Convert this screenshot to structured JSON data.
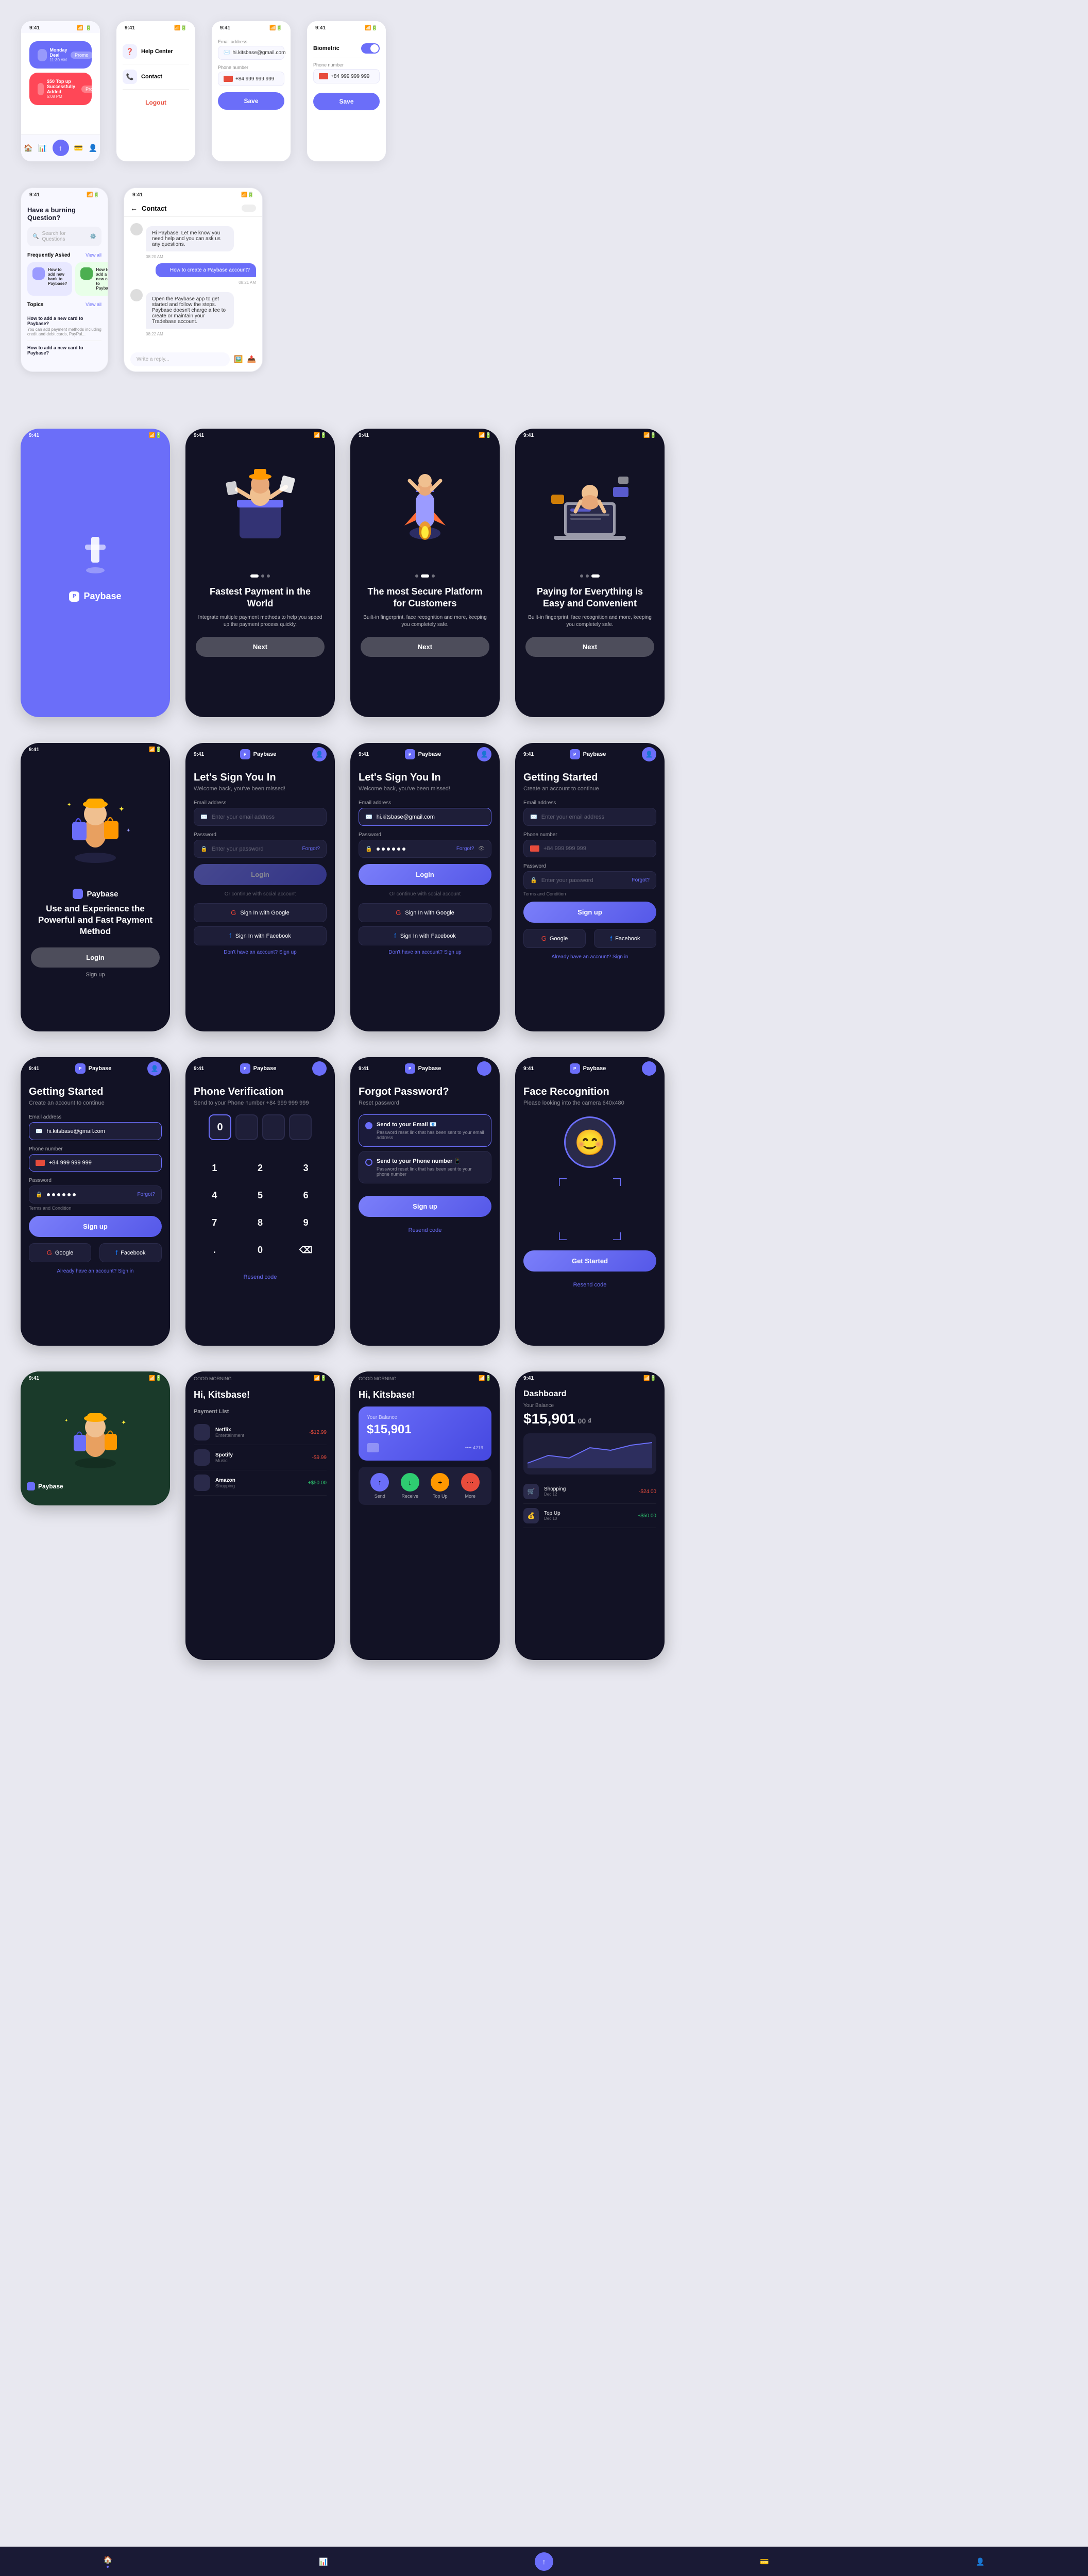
{
  "app": {
    "name": "Paybase",
    "logo_text": "Paybase",
    "tagline": "Use and Experience the Powerful and Fast Payment Method"
  },
  "status_bar": {
    "time": "9:41",
    "time_good_morning": "GOOD MORNING"
  },
  "row1": {
    "screens": [
      {
        "id": "notifications",
        "items": [
          {
            "title": "Monday Deal",
            "amount": "11:30 AM",
            "badge": "Promo",
            "color": "blue"
          },
          {
            "title": "$50 Top up Successfully Added",
            "amount": "5:08 PM",
            "badge": "Promo",
            "color": "red"
          }
        ],
        "nav": [
          "home",
          "activity",
          "send",
          "card",
          "profile"
        ]
      },
      {
        "id": "help-center",
        "title": "Help Center",
        "contact": "Contact",
        "logout": "Logout"
      },
      {
        "id": "profile-settings",
        "email_label": "Email address",
        "email_value": "hi.kitsbase@gmail.com",
        "phone_label": "Phone number",
        "phone_value": "+84 999 999 999",
        "save_btn": "Save"
      },
      {
        "id": "biometric",
        "title": "Biometric",
        "phone_label": "Phone number",
        "phone_value": "+84 999 999 999",
        "save_btn": "Save"
      }
    ]
  },
  "row2": {
    "faq": {
      "title": "Have a burning Question?",
      "search_placeholder": "Search for Questions",
      "frequently_asked": "Frequently Asked",
      "view_all": "View all",
      "topics": "Topics",
      "topics_view_all": "View all",
      "cards": [
        {
          "title": "How to add new bank to Paybase?"
        },
        {
          "title": "How to add a new card to Paybase?"
        }
      ],
      "topic_items": [
        {
          "title": "How to add a new card to Paybase?",
          "desc": "You can add payment methods including credit and debit cards, PayPal..."
        },
        {
          "title": "How to add a new card to Paybase?",
          "desc": ""
        }
      ]
    },
    "chat": {
      "title": "Contact",
      "messages": [
        {
          "side": "left",
          "text": "Hi Paybase, Let me know you need help and you can ask us any questions.",
          "time": "08:20 AM"
        },
        {
          "side": "right",
          "text": "How to create a Paybase account?",
          "time": "08:21 AM"
        },
        {
          "side": "left",
          "text": "Open the Paybase app to get started and follow the steps. Paybase doesn't charge a fee to create or maintain your Tradebase account.",
          "time": "08:22 AM"
        }
      ],
      "reply_placeholder": "Write a reply..."
    }
  },
  "onboarding": {
    "splash": {
      "logo": "Paybase"
    },
    "slides": [
      {
        "title": "Fastest Payment in the World",
        "desc": "Integrate multiple payment methods to help you speed up the payment process quickly.",
        "dot_active": 0
      },
      {
        "title": "The most Secure Platform for Customers",
        "desc": "Built-in fingerprint, face recognition and more, keeping you completely safe.",
        "dot_active": 1
      },
      {
        "title": "Paying for Everything is Easy and Convenient",
        "desc": "Built-in fingerprint, face recognition and more, keeping you completely safe.",
        "dot_active": 2
      }
    ],
    "next_btn": "Next"
  },
  "auth": {
    "welcome_back": "Welcome back, you've been missed!",
    "sign_in_title": "Let's Sign You In",
    "getting_started_title": "Getting Started",
    "getting_started_subtitle": "Create an account to continue",
    "email_label": "Email address",
    "email_placeholder": "Enter your email address",
    "email_value": "hi.kitsbase@gmail.com",
    "password_label": "Password",
    "password_placeholder": "Enter your password",
    "forgot_password": "Forgot?",
    "login_btn": "Login",
    "or_continue": "Or continue with social account",
    "google_btn": "Sign In with Google",
    "facebook_btn": "Sign In with Facebook",
    "no_account": "Don't have an account?",
    "signup_link": "Sign up",
    "phone_label": "Phone number",
    "phone_value": "+84 999 999 999",
    "phone_placeholder": "+84 999 999 999",
    "signup_btn": "Sign up",
    "already_have": "Already have an account?",
    "signin_link": "Sign in",
    "terms": "Terms and Condition",
    "google_label": "Google",
    "facebook_label": "Facebook"
  },
  "phone_verify": {
    "title": "Phone Verification",
    "subtitle": "Send to your Phone number +84 999 999 999",
    "code_digits": [
      "0",
      "",
      "",
      ""
    ],
    "numpad": [
      "1",
      "2",
      "3",
      "4",
      "5",
      "6",
      "7",
      "8",
      "9",
      ".",
      "0",
      "⌫"
    ],
    "resend": "Resend code",
    "send_to_phone": "Send to your Phone number"
  },
  "forgot_password": {
    "title": "Forgot Password?",
    "subtitle": "Reset password",
    "options": [
      {
        "id": "email",
        "label": "Send to your Email 📧",
        "desc": "Password reset link that has been sent to your email address",
        "selected": true
      },
      {
        "id": "phone",
        "label": "Send to your Phone number 📱",
        "desc": "Password reset link that has been sent to your phone number",
        "selected": false
      }
    ],
    "signup_btn": "Sign up",
    "resend": "Resend code"
  },
  "face_recognition": {
    "title": "Face Recognition",
    "subtitle": "Please looking into the camera 640x480",
    "get_started_btn": "Get Started",
    "resend": "Resend code"
  },
  "home": {
    "greeting_label": "GOOD MORNING",
    "greeting_name": "Hi, Kitsbase!",
    "payment_list_label": "Payment List",
    "dashboard_label": "Dashboard",
    "balance_label": "Your Balance",
    "balance_amount": "$15,901",
    "balance_suffix": "00 ₫"
  }
}
